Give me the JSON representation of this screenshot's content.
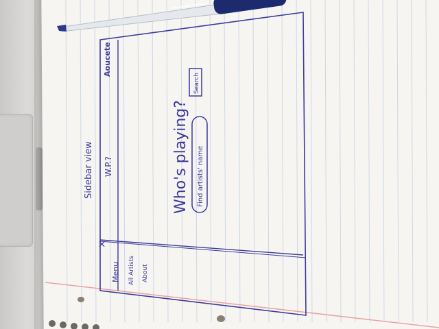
{
  "sketch": {
    "page_title": "Sidebar view",
    "header": {
      "brand_label": "Aoucete",
      "tab_label": "W.P.?"
    },
    "main": {
      "heading": "Who's playing?",
      "search_placeholder": "Find artists' name",
      "search_button": "Search"
    },
    "sidebar": {
      "close_glyph": "×",
      "menu_label": "Menu",
      "items": [
        {
          "label": "All Artists"
        },
        {
          "label": "About"
        }
      ]
    }
  },
  "colors": {
    "ink": "#3b3a9a",
    "pen_cap": "#1e2a6e",
    "margin_line": "#e8a3a0",
    "rule_line": "#cfd6e4"
  }
}
